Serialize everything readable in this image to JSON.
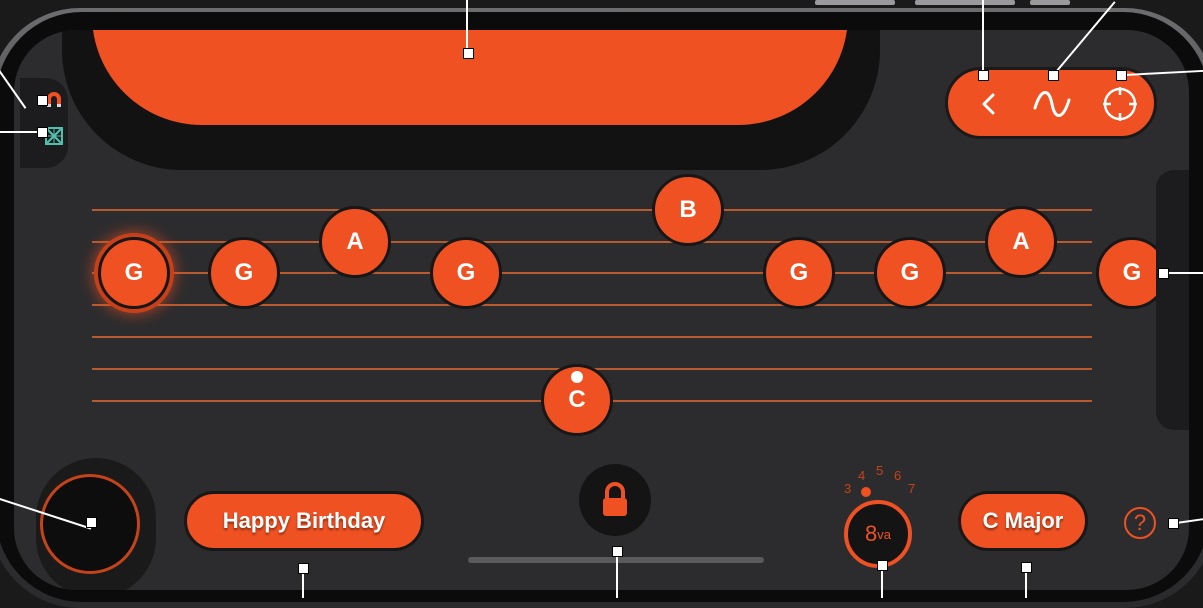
{
  "colors": {
    "accent": "#f05122",
    "background": "#2c2c2e",
    "staff_line": "#b85a30",
    "note_text": "#ffffff"
  },
  "left_panel": {
    "magnet_icon": "magnet-icon",
    "grid_toggle_icon": "grid-off-icon"
  },
  "toolbar": {
    "back_icon": "chevron-left-icon",
    "wave_icon": "wave-icon",
    "target_icon": "crosshair-icon"
  },
  "notes": [
    {
      "label": "G",
      "active": true
    },
    {
      "label": "G",
      "active": false
    },
    {
      "label": "A",
      "active": false
    },
    {
      "label": "G",
      "active": false
    },
    {
      "label": "C",
      "active": false,
      "dot": true
    },
    {
      "label": "B",
      "active": false
    },
    {
      "label": "G",
      "active": false
    },
    {
      "label": "G",
      "active": false
    },
    {
      "label": "A",
      "active": false
    },
    {
      "label": "G",
      "active": false
    }
  ],
  "song_button": {
    "label": "Happy Birthday"
  },
  "key_button": {
    "label": "C Major"
  },
  "octave": {
    "label": "8",
    "superscript": "va",
    "numbers": [
      "3",
      "4",
      "5",
      "6",
      "7"
    ],
    "selected": "4"
  },
  "help": {
    "label": "?"
  },
  "lock_icon": "lock-icon"
}
